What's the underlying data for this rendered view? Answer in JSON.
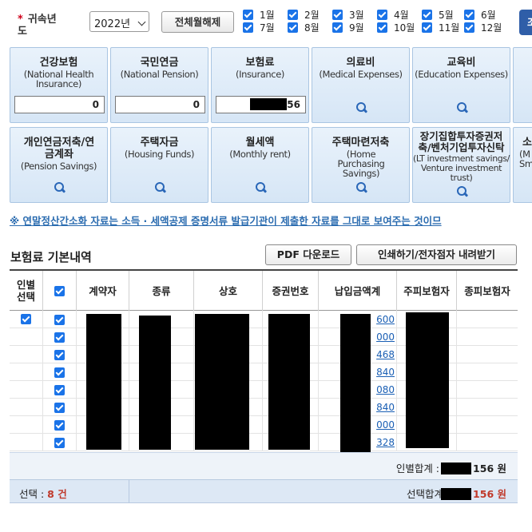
{
  "header": {
    "year_label": "귀속년도",
    "year_value": "2022년",
    "uncheck_all_label": "전체월해제",
    "search_label": "조"
  },
  "months": [
    "1월",
    "2월",
    "3월",
    "4월",
    "5월",
    "6월",
    "7월",
    "8월",
    "9월",
    "10월",
    "11월",
    "12월"
  ],
  "categories": [
    {
      "title": "건강보험",
      "sub": "(National Health Insurance)",
      "amount": "0"
    },
    {
      "title": "국민연금",
      "sub": "(National Pension)",
      "amount": "0"
    },
    {
      "title": "보험료",
      "sub": "(Insurance)",
      "amount": "56"
    },
    {
      "title": "의료비",
      "sub": "(Medical Expenses)"
    },
    {
      "title": "교육비",
      "sub": "(Education Expenses)"
    },
    {
      "title": "개인연금저축/연금계좌",
      "sub": "(Pension Savings)"
    },
    {
      "title": "주택자금",
      "sub": "(Housing Funds)"
    },
    {
      "title": "월세액",
      "sub": "(Monthly rent)"
    },
    {
      "title": "주택마련저축",
      "sub": "(Home Purchasing Savings)"
    },
    {
      "title": "장기집합투자증권저축/벤처기업투자신탁",
      "sub": "(LT investment savings/ Venture investment trust)"
    },
    {
      "title": "소",
      "sub": "(M Sm"
    }
  ],
  "notice": "※ 연말정산간소화 자료는 소득 · 세액공제 증명서류 발급기관이 제출한 자료를 그대로 보여주는 것이므",
  "section": {
    "title": "보험료 기본내역",
    "pdf_download": "PDF 다운로드",
    "print_download": "인쇄하기/전자점자 내려받기"
  },
  "table": {
    "headers": [
      "인별선택",
      "",
      "계약자",
      "종류",
      "상호",
      "증권번호",
      "납입금액계",
      "주피보험자",
      "종피보험자"
    ],
    "amounts": [
      "600",
      "000",
      "468",
      "840",
      "080",
      "840",
      "000",
      "328"
    ]
  },
  "summary": {
    "person_total_label": "인별합계 :",
    "person_total_value": "156 원",
    "selected_label": "선택 :",
    "selected_count": "8 건",
    "selected_total_label": "선택합계",
    "selected_total_value": "156 원"
  },
  "colors": {
    "accent": "#1a73e8",
    "card_bg": "#dbe8f5",
    "link": "#1a5fb4",
    "emphasis": "#c0392b"
  }
}
